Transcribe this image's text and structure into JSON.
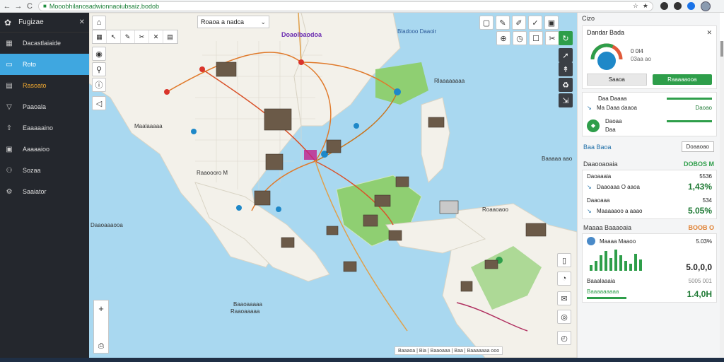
{
  "browser": {
    "url": "Mooobhilanosadwionnaoiubsaiz.bodob",
    "nav_back": "←",
    "nav_forward": "→",
    "nav_reload": "C"
  },
  "sidebar": {
    "title": "Fugizae",
    "items": [
      {
        "label": "Dacastlaiaide",
        "icon": "grid-icon",
        "state": "normal"
      },
      {
        "label": "Roto",
        "icon": "layer-icon",
        "state": "active"
      },
      {
        "label": "Rasoato",
        "icon": "folder-icon",
        "state": "warn"
      },
      {
        "label": "Paaoala",
        "icon": "filter-icon",
        "state": "normal"
      },
      {
        "label": "Eaaaaaino",
        "icon": "upload-icon",
        "state": "normal"
      },
      {
        "label": "Aaaaaioo",
        "icon": "document-icon",
        "state": "normal"
      },
      {
        "label": "Sozaa",
        "icon": "user-icon",
        "state": "normal"
      },
      {
        "label": "Saaiator",
        "icon": "settings-icon",
        "state": "normal"
      }
    ]
  },
  "map": {
    "layer_select": "Roaoa a nadca",
    "labels": {
      "top_center": "Doaolbaodoa",
      "top_right": "Bladooo Daaoir",
      "right_1": "Rlaaaaaaaa",
      "left_1": "Maalaaaaa",
      "left_2": "Raaoooro M",
      "right_2": "Baaaaa aao",
      "right_3": "Roaaoaoo",
      "left_3": "Daaoaaaooa",
      "bottom_1": "Baaoaaaaa",
      "bottom_2": "Raaoaaaaa"
    },
    "footer": "Baaaoa | Bia | Baaoaaa | Baa | Baaaaaaa ooo"
  },
  "panel": {
    "header": "Cizo",
    "card1": {
      "title": "Dandar Bada",
      "gauge_pct": 64,
      "gauge_value": "0 0I4",
      "gauge_sub": "03aa ao",
      "button_grey": "Saaoa",
      "button_green": "Raaaaaooa"
    },
    "row1": {
      "title": "Daa Daaaa",
      "sub": "Ma Daaa daaoa",
      "value": "Daoao",
      "bar_pct": 70
    },
    "row2": {
      "title": "Daoaa",
      "sub": "Daa",
      "bar_pct": 70
    },
    "section1": {
      "title": "Baa Baoa",
      "button": "Doaaoao"
    },
    "section2": {
      "title": "Daaooaoaia",
      "value": "DOBOS M"
    },
    "stat1": {
      "title": "Daoaaaia",
      "value_small": "5536",
      "sub": "Daaoaaa O aaoa",
      "value_big": "1,43%"
    },
    "stat2": {
      "title": "Daaoaaa",
      "value_small": "534",
      "sub": "Maaaaaoo a aaao",
      "value_big": "5.05%"
    },
    "section3": {
      "title": "Maaaa Baaaoaia",
      "value": "BOOB O"
    },
    "stat3": {
      "title": "Maaaa Maaoo",
      "value_small": "5.03%",
      "value_big": "5.0,0,0"
    },
    "bars": [
      8,
      14,
      22,
      28,
      18,
      30,
      22,
      14,
      10,
      24,
      16
    ],
    "stat4": {
      "title": "Baaalaaaia",
      "value_small": "5005 001",
      "sub": "Baaaaaaaaa",
      "value_big": "1.4,0H"
    }
  }
}
